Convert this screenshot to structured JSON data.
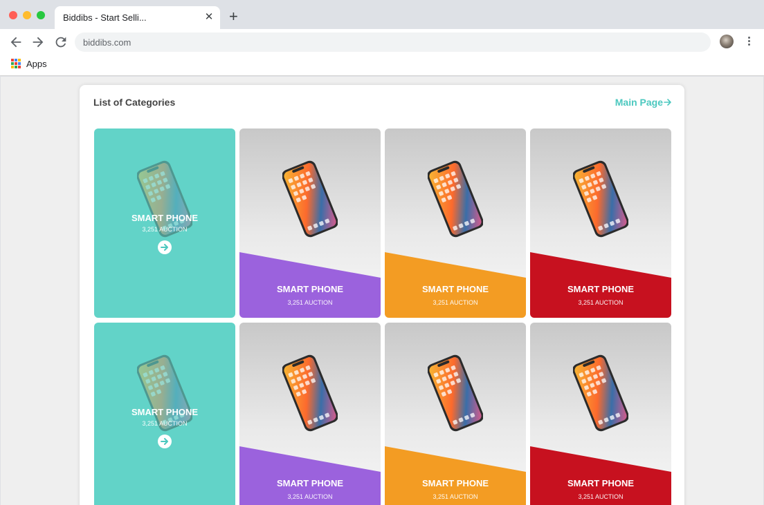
{
  "browser": {
    "tab_title": "Biddibs - Start Selli...",
    "close_glyph": "✕",
    "new_tab_glyph": "+",
    "url": "biddibs.com",
    "bookmark_label": "Apps"
  },
  "page": {
    "heading": "List of Categories",
    "main_link": "Main Page",
    "accent_color": "#4cc8bf",
    "rows": [
      {
        "cards": [
          {
            "title": "SMART PHONE",
            "subtitle": "3,251 AUCTION",
            "style": "teal",
            "color": "#62d3c8"
          },
          {
            "title": "SMART PHONE",
            "subtitle": "3,251 AUCTION",
            "style": "purple",
            "color": "#9b62dd"
          },
          {
            "title": "SMART PHONE",
            "subtitle": "3,251 AUCTION",
            "style": "orange",
            "color": "#f39c23"
          },
          {
            "title": "SMART PHONE",
            "subtitle": "3,251 AUCTION",
            "style": "red",
            "color": "#c7111f"
          }
        ]
      },
      {
        "cards": [
          {
            "title": "SMART PHONE",
            "subtitle": "3,251 AUCTION",
            "style": "teal",
            "color": "#62d3c8"
          },
          {
            "title": "SMART PHONE",
            "subtitle": "3,251 AUCTION",
            "style": "purple",
            "color": "#9b62dd"
          },
          {
            "title": "SMART PHONE",
            "subtitle": "3,251 AUCTION",
            "style": "orange",
            "color": "#f39c23"
          },
          {
            "title": "SMART PHONE",
            "subtitle": "3,251 AUCTION",
            "style": "red",
            "color": "#c7111f"
          }
        ]
      }
    ]
  }
}
